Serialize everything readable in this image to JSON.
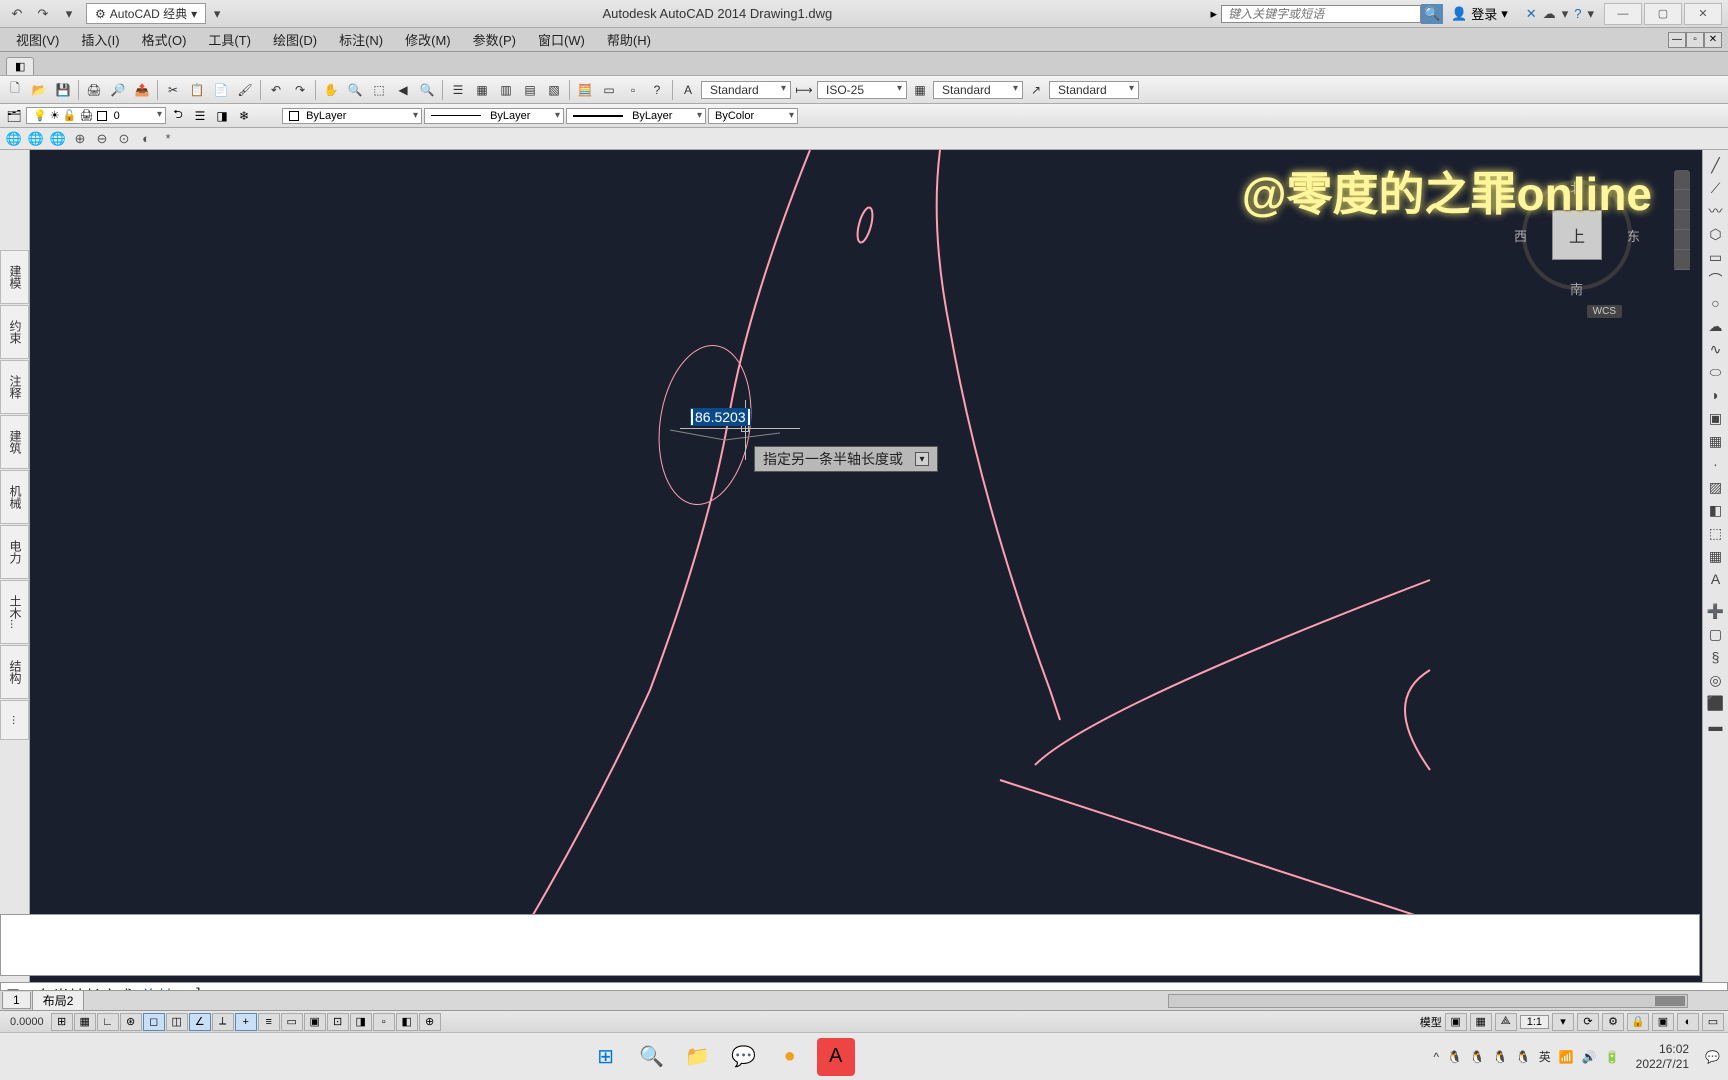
{
  "titlebar": {
    "workspace": "AutoCAD 经典",
    "app_title": "Autodesk AutoCAD 2014   Drawing1.dwg",
    "search_placeholder": "键入关键字或短语",
    "login": "登录"
  },
  "menubar": {
    "items": [
      "视图(V)",
      "插入(I)",
      "格式(O)",
      "工具(T)",
      "绘图(D)",
      "标注(N)",
      "修改(M)",
      "参数(P)",
      "窗口(W)",
      "帮助(H)"
    ]
  },
  "toolbar": {
    "text_style": "Standard",
    "dim_style": "ISO-25",
    "table_style": "Standard",
    "mleader_style": "Standard"
  },
  "layer_row": {
    "layer_name": "0",
    "color": "ByLayer",
    "linetype": "ByLayer",
    "lineweight": "ByLayer",
    "plotstyle": "ByColor"
  },
  "viewcube": {
    "face": "上",
    "north": "北",
    "south": "南",
    "west": "西",
    "east": "东",
    "wcs": "WCS"
  },
  "left_tabs": [
    "建模",
    "约束",
    "注释",
    "建筑",
    "机械",
    "电力",
    "土木...",
    "结构",
    "..."
  ],
  "dynamic_input": {
    "value": "86.5203",
    "prompt": "指定另一条半轴长度或"
  },
  "command_line": {
    "text_prefix": "另一条半轴长度或 [",
    "option": "旋转(R)",
    "text_suffix": "]:"
  },
  "layout_tabs": [
    "1",
    "布局2"
  ],
  "statusbar": {
    "coord": "0.0000",
    "model": "模型",
    "scale": "1:1"
  },
  "watermark": "@零度的之罪online",
  "taskbar": {
    "ime": "英",
    "time": "16:02",
    "date": "2022/7/21"
  },
  "colors": {
    "canvas_bg": "#1a1f2e",
    "drawing_stroke": "#ff9faf"
  }
}
